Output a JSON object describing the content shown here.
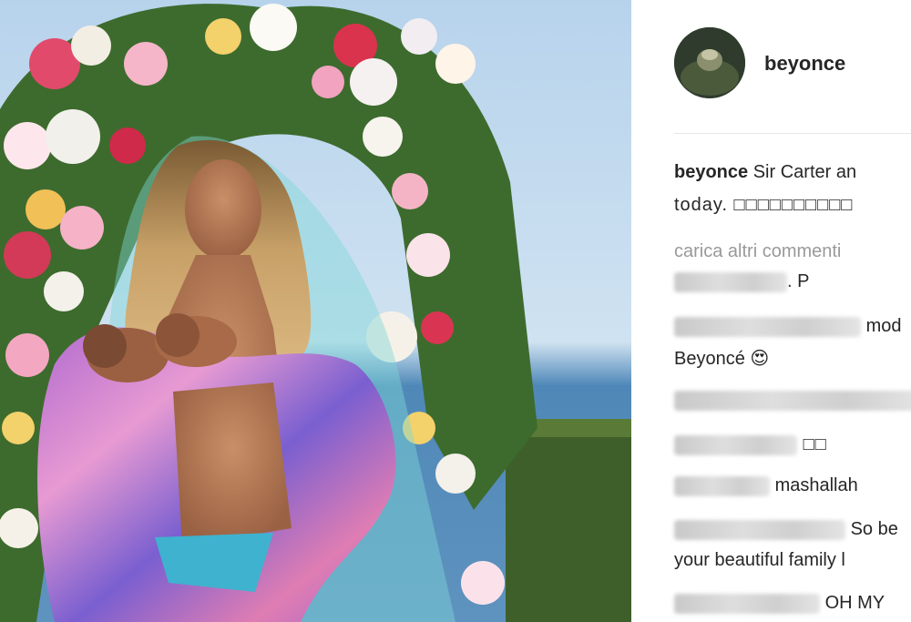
{
  "post": {
    "username": "beyonce",
    "caption_user": "beyonce",
    "caption_line1": "Sir Carter an",
    "caption_line2": "today. □□□□□□□□□□"
  },
  "comments": {
    "load_more": "carica altri commenti",
    "items": [
      {
        "text": ". P"
      },
      {
        "text": "mod",
        "continuation": "Beyoncé 😍"
      },
      {
        "text": ""
      },
      {
        "text": "□□"
      },
      {
        "text": "mashallah"
      },
      {
        "text": "So be",
        "continuation": "your beautiful family l"
      },
      {
        "text": "OH MY"
      }
    ]
  },
  "colors": {
    "text": "#262626",
    "muted": "#999999"
  }
}
